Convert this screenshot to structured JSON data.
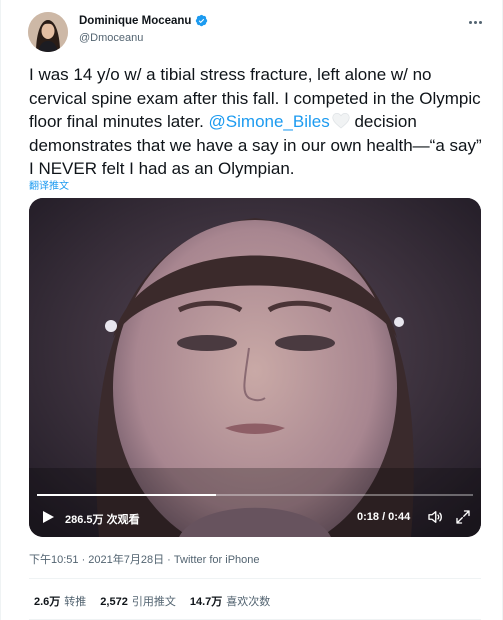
{
  "author": {
    "display_name": "Dominique Moceanu",
    "handle": "@Dmoceanu",
    "verified": true
  },
  "tweet": {
    "text_before_mention": "I was 14 y/o w/ a tibial stress fracture, left alone w/ no cervical spine exam after this fall. I competed in the Olympic floor final minutes later. ",
    "mention": "@Simone_Biles",
    "text_after_mention": " decision demonstrates that we have a say in our own health—“a say” I NEVER felt I had as an Olympian.",
    "translate_label": "翻译推文"
  },
  "video": {
    "views": "286.5万 次观看",
    "time": "0:18 / 0:44",
    "progress_fraction": 0.41
  },
  "meta": {
    "timestamp": "下午10:51 · 2021年7月28日 · ",
    "source": "Twitter for iPhone"
  },
  "stats": {
    "retweets_value": "2.6万",
    "retweets_label": "转推",
    "quotes_value": "2,572",
    "quotes_label": "引用推文",
    "likes_value": "14.7万",
    "likes_label": "喜欢次数"
  },
  "colors": {
    "accent": "#1d9bf0",
    "text": "#0f1419",
    "secondary": "#536471"
  }
}
